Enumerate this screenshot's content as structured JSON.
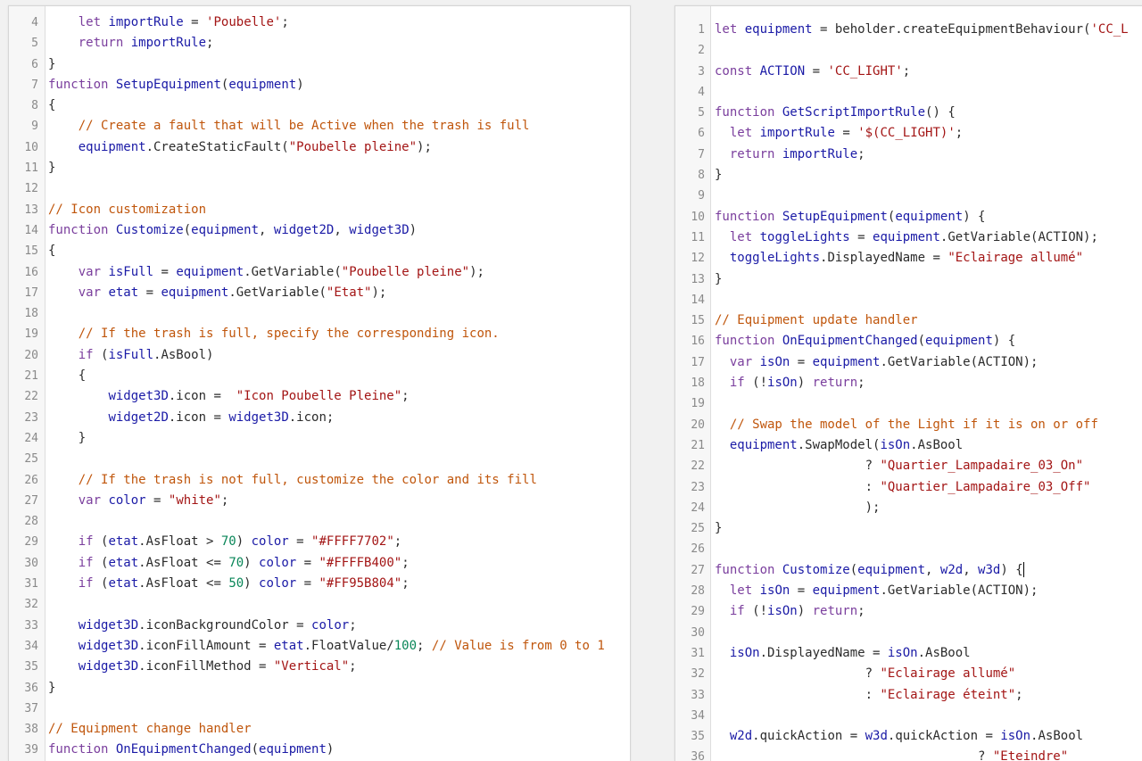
{
  "colors": {
    "keyword": "#7a3e9d",
    "identifier": "#1a1aa6",
    "string": "#a31515",
    "comment": "#c0560c",
    "number": "#098658",
    "plain": "#2b2b2b"
  },
  "left_editor": {
    "lines": [
      {
        "n": "4",
        "t": "    let importRule = 'Poubelle';"
      },
      {
        "n": "5",
        "t": "    return importRule;"
      },
      {
        "n": "6",
        "t": "}"
      },
      {
        "n": "7",
        "t": "function SetupEquipment(equipment)"
      },
      {
        "n": "8",
        "t": "{"
      },
      {
        "n": "9",
        "t": "    // Create a fault that will be Active when the trash is full"
      },
      {
        "n": "10",
        "t": "    equipment.CreateStaticFault(\"Poubelle pleine\");"
      },
      {
        "n": "11",
        "t": "}"
      },
      {
        "n": "12",
        "t": ""
      },
      {
        "n": "13",
        "t": "// Icon customization"
      },
      {
        "n": "14",
        "t": "function Customize(equipment, widget2D, widget3D)"
      },
      {
        "n": "15",
        "t": "{"
      },
      {
        "n": "16",
        "t": "    var isFull = equipment.GetVariable(\"Poubelle pleine\");"
      },
      {
        "n": "17",
        "t": "    var etat = equipment.GetVariable(\"Etat\");"
      },
      {
        "n": "18",
        "t": ""
      },
      {
        "n": "19",
        "t": "    // If the trash is full, specify the corresponding icon."
      },
      {
        "n": "20",
        "t": "    if (isFull.AsBool)"
      },
      {
        "n": "21",
        "t": "    {"
      },
      {
        "n": "22",
        "t": "        widget3D.icon =  \"Icon Poubelle Pleine\";"
      },
      {
        "n": "23",
        "t": "        widget2D.icon = widget3D.icon;"
      },
      {
        "n": "24",
        "t": "    }"
      },
      {
        "n": "25",
        "t": ""
      },
      {
        "n": "26",
        "t": "    // If the trash is not full, customize the color and its fill"
      },
      {
        "n": "27",
        "t": "    var color = \"white\";"
      },
      {
        "n": "28",
        "t": ""
      },
      {
        "n": "29",
        "t": "    if (etat.AsFloat > 70) color = \"#FFFF7702\";"
      },
      {
        "n": "30",
        "t": "    if (etat.AsFloat <= 70) color = \"#FFFFB400\";"
      },
      {
        "n": "31",
        "t": "    if (etat.AsFloat <= 50) color = \"#FF95B804\";"
      },
      {
        "n": "32",
        "t": ""
      },
      {
        "n": "33",
        "t": "    widget3D.iconBackgroundColor = color;"
      },
      {
        "n": "34",
        "t": "    widget3D.iconFillAmount = etat.FloatValue/100; // Value is from 0 to 1"
      },
      {
        "n": "35",
        "t": "    widget3D.iconFillMethod = \"Vertical\";"
      },
      {
        "n": "36",
        "t": "}"
      },
      {
        "n": "37",
        "t": ""
      },
      {
        "n": "38",
        "t": "// Equipment change handler"
      },
      {
        "n": "39",
        "t": "function OnEquipmentChanged(equipment)"
      }
    ]
  },
  "right_editor": {
    "lines": [
      {
        "n": "1",
        "t": "let equipment = beholder.createEquipmentBehaviour('CC_L"
      },
      {
        "n": "2",
        "t": ""
      },
      {
        "n": "3",
        "t": "const ACTION = 'CC_LIGHT';"
      },
      {
        "n": "4",
        "t": ""
      },
      {
        "n": "5",
        "t": "function GetScriptImportRule() {"
      },
      {
        "n": "6",
        "t": "  let importRule = '$(CC_LIGHT)';"
      },
      {
        "n": "7",
        "t": "  return importRule;"
      },
      {
        "n": "8",
        "t": "}"
      },
      {
        "n": "9",
        "t": ""
      },
      {
        "n": "10",
        "t": "function SetupEquipment(equipment) {"
      },
      {
        "n": "11",
        "t": "  let toggleLights = equipment.GetVariable(ACTION);"
      },
      {
        "n": "12",
        "t": "  toggleLights.DisplayedName = \"Eclairage allumé\""
      },
      {
        "n": "13",
        "t": "}"
      },
      {
        "n": "14",
        "t": ""
      },
      {
        "n": "15",
        "t": "// Equipment update handler"
      },
      {
        "n": "16",
        "t": "function OnEquipmentChanged(equipment) {"
      },
      {
        "n": "17",
        "t": "  var isOn = equipment.GetVariable(ACTION);"
      },
      {
        "n": "18",
        "t": "  if (!isOn) return;"
      },
      {
        "n": "19",
        "t": ""
      },
      {
        "n": "20",
        "t": "  // Swap the model of the Light if it is on or off"
      },
      {
        "n": "21",
        "t": "  equipment.SwapModel(isOn.AsBool"
      },
      {
        "n": "22",
        "t": "                    ? \"Quartier_Lampadaire_03_On\""
      },
      {
        "n": "23",
        "t": "                    : \"Quartier_Lampadaire_03_Off\""
      },
      {
        "n": "24",
        "t": "                    );"
      },
      {
        "n": "25",
        "t": "}"
      },
      {
        "n": "26",
        "t": ""
      },
      {
        "n": "27",
        "t": "function Customize(equipment, w2d, w3d) {"
      },
      {
        "n": "28",
        "t": "  let isOn = equipment.GetVariable(ACTION);"
      },
      {
        "n": "29",
        "t": "  if (!isOn) return;"
      },
      {
        "n": "30",
        "t": ""
      },
      {
        "n": "31",
        "t": "  isOn.DisplayedName = isOn.AsBool"
      },
      {
        "n": "32",
        "t": "                    ? \"Eclairage allumé\""
      },
      {
        "n": "33",
        "t": "                    : \"Eclairage éteint\";"
      },
      {
        "n": "34",
        "t": ""
      },
      {
        "n": "35",
        "t": "  w2d.quickAction = w3d.quickAction = isOn.AsBool"
      },
      {
        "n": "36",
        "t": "                                   ? \"Eteindre\""
      }
    ]
  }
}
